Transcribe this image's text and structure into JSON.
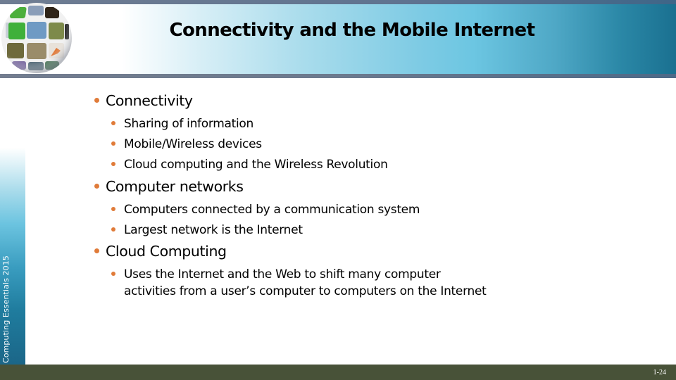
{
  "slide": {
    "title": "Connectivity and the Mobile Internet",
    "side_label": "Computing Essentials 2015",
    "page_number": "1-24",
    "colors": {
      "bullet": "#e07b39",
      "footer_bar": "#485238",
      "header_rule": "#6c7a8e"
    }
  },
  "bullets": [
    {
      "text": "Connectivity",
      "children": [
        {
          "text": "Sharing of information"
        },
        {
          "text": "Mobile/Wireless devices"
        },
        {
          "text": "Cloud computing and the Wireless Revolution"
        }
      ]
    },
    {
      "text": "Computer networks",
      "children": [
        {
          "text": "Computers connected by a communication system"
        },
        {
          "text": "Largest network is the Internet"
        }
      ]
    },
    {
      "text": "Cloud Computing",
      "children": [
        {
          "text": "Uses the Internet and the Web to shift many computer activities from a user’s computer to computers on the Internet"
        }
      ]
    }
  ],
  "icons": {
    "logo": "globe-photo-collage-icon",
    "bullet": "orange-dot"
  }
}
